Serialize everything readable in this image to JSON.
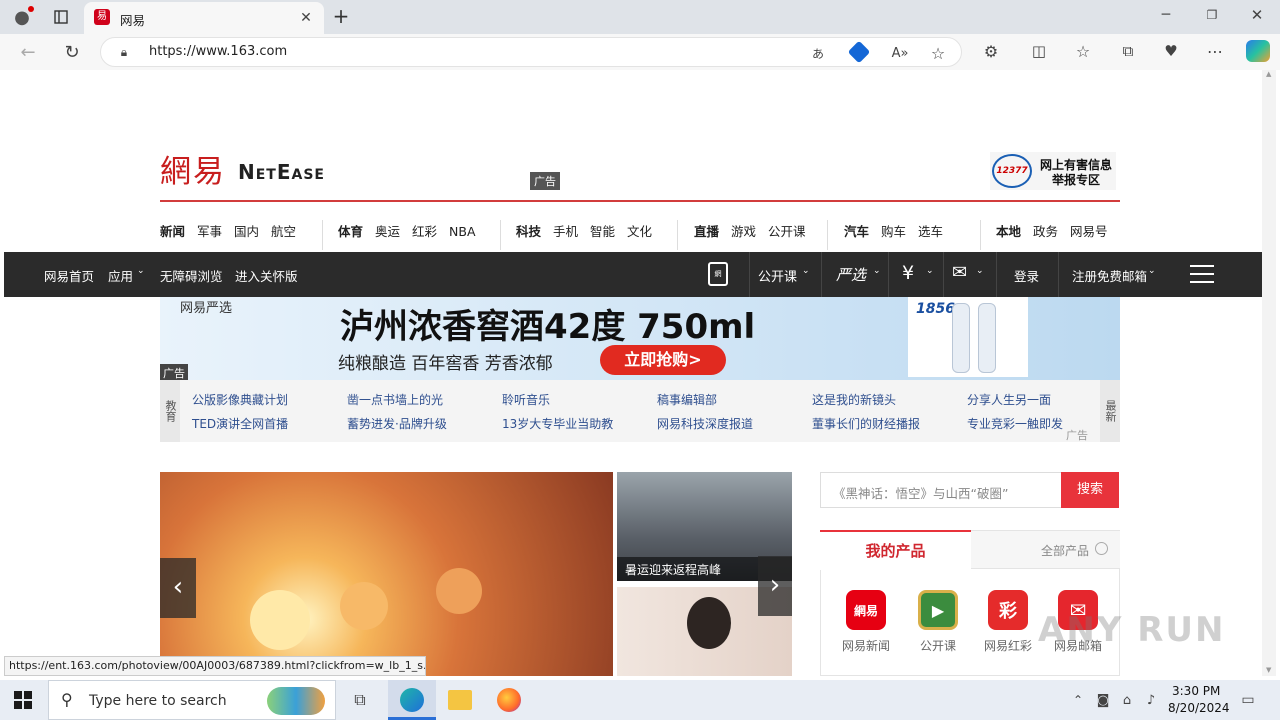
{
  "browser": {
    "tab_title": "网易",
    "url": "https://www.163.com",
    "status_url": "https://ent.163.com/photoview/00AJ0003/687389.html?clickfrom=w_lb_1_s..."
  },
  "logo": {
    "cn": "網易",
    "en": "NetEase"
  },
  "report": {
    "badge": "12377",
    "line1": "网上有害信息",
    "line2": "举报专区"
  },
  "ad_tag": "广告",
  "nav": [
    [
      "新闻",
      "军事",
      "国内",
      "航空"
    ],
    [
      "体育",
      "奥运",
      "红彩",
      "NBA"
    ],
    [
      "科技",
      "手机",
      "智能",
      "文化"
    ],
    [
      "直播",
      "游戏",
      "公开课"
    ],
    [
      "汽车",
      "购车",
      "选车"
    ],
    [
      "本地",
      "政务",
      "网易号"
    ]
  ],
  "blackbar": {
    "left": [
      "网易首页",
      "应用",
      "无障碍浏览",
      "进入关怀版"
    ],
    "right": [
      "公开课",
      "严选",
      "登录",
      "注册免费邮箱"
    ]
  },
  "banner": {
    "brand": "网易严选",
    "title": "泸州浓香窖酒42度 750ml",
    "sub": "纯粮酿造 百年窖香 芳香浓郁",
    "cta": "立即抢购>",
    "bottle_label": "1856",
    "tag": "广告"
  },
  "edu": {
    "left_label": "教育",
    "right_label": "最新",
    "tag": "广告",
    "links": [
      [
        "公版影像典藏计划",
        "TED演讲全网首播"
      ],
      [
        "凿一点书墙上的光",
        "蓄势进发·品牌升级"
      ],
      [
        "聆听音乐",
        "13岁大专毕业当助教"
      ],
      [
        "稿事编辑部",
        "网易科技深度报道"
      ],
      [
        "这是我的新镜头",
        "董事长们的财经播报"
      ],
      [
        "分享人生另一面",
        "专业竞彩一触即发"
      ]
    ]
  },
  "carousel": {
    "caption1": "暑运迎来返程高峰"
  },
  "search": {
    "placeholder": "《黑神话：悟空》与山西“破圈”",
    "button": "搜索"
  },
  "products": {
    "tab_active": "我的产品",
    "tab_other": "全部产品",
    "items": [
      {
        "label": "网易新闻",
        "icon": "news-icon",
        "color": "#e60012",
        "glyph": "網易"
      },
      {
        "label": "公开课",
        "icon": "open-course-icon",
        "color": "#3b8c3e",
        "glyph": "▶"
      },
      {
        "label": "网易红彩",
        "icon": "lottery-icon",
        "color": "#e52b2b",
        "glyph": "彩"
      },
      {
        "label": "网易邮箱",
        "icon": "mail-icon",
        "color": "#e5262d",
        "glyph": "✉"
      }
    ]
  },
  "taskbar": {
    "search": "Type here to search",
    "time": "3:30 PM",
    "date": "8/20/2024"
  },
  "watermark": "ANY RUN"
}
